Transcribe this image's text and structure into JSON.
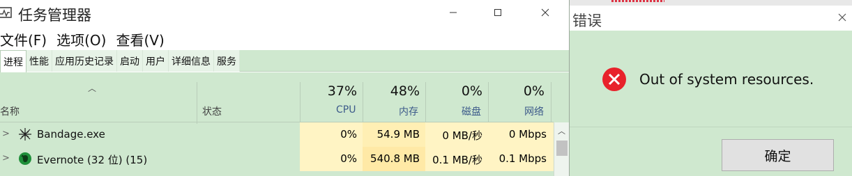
{
  "task_manager": {
    "title": "任务管理器",
    "menu": [
      "文件(F)",
      "选项(O)",
      "查看(V)"
    ],
    "tabs": [
      "进程",
      "性能",
      "应用历史记录",
      "启动",
      "用户",
      "详细信息",
      "服务"
    ],
    "active_tab": 0,
    "columns": {
      "name": "名称",
      "status": "状态",
      "cpu": {
        "percent": "37%",
        "label": "CPU"
      },
      "memory": {
        "percent": "48%",
        "label": "内存"
      },
      "disk": {
        "percent": "0%",
        "label": "磁盘"
      },
      "network": {
        "percent": "0%",
        "label": "网络"
      }
    },
    "rows": [
      {
        "name": "Bandage.exe",
        "icon": "bandage-icon",
        "cpu": "0%",
        "memory": "54.9 MB",
        "disk": "0 MB/秒",
        "network": "0 Mbps"
      },
      {
        "name": "Evernote (32 位) (15)",
        "icon": "evernote-icon",
        "cpu": "0%",
        "memory": "540.8 MB",
        "disk": "0.1 MB/秒",
        "network": "0.1 Mbps"
      }
    ]
  },
  "error_dialog": {
    "title": "错误",
    "message": "Out of system resources.",
    "ok_label": "确定",
    "icon": "error-icon"
  }
}
